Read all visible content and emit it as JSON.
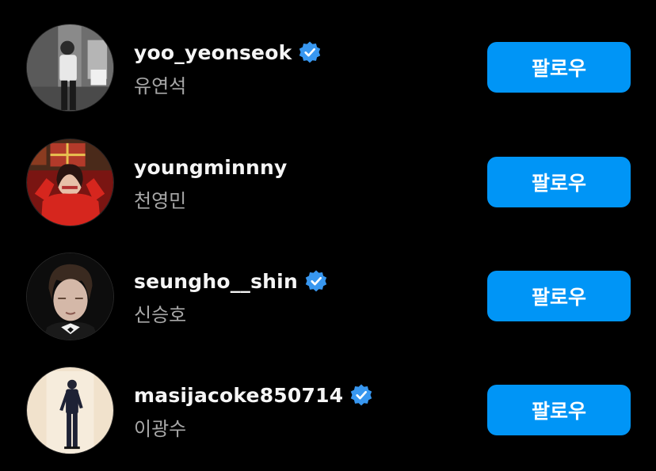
{
  "colors": {
    "background": "#000000",
    "follow_button": "#0095f6",
    "verified_badge": "#3897f0",
    "secondary_text": "#a8a8a8"
  },
  "users": [
    {
      "username": "yoo_yeonseok",
      "full_name": "유연석",
      "verified": true,
      "follow_label": "팔로우"
    },
    {
      "username": "youngminnny",
      "full_name": "천영민",
      "verified": false,
      "follow_label": "팔로우"
    },
    {
      "username": "seungho__shin",
      "full_name": "신승호",
      "verified": true,
      "follow_label": "팔로우"
    },
    {
      "username": "masijacoke850714",
      "full_name": "이광수",
      "verified": true,
      "follow_label": "팔로우"
    }
  ]
}
